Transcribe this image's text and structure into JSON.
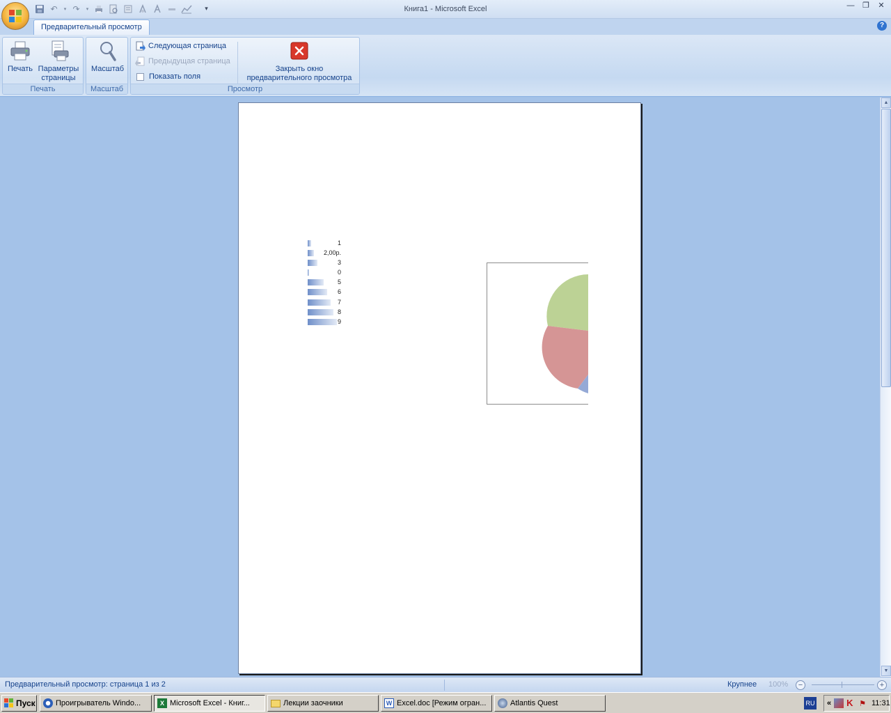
{
  "window": {
    "title": "Книга1  - Microsoft Excel",
    "controls": [
      "minimize-icon",
      "restore-icon",
      "close-icon"
    ]
  },
  "qat": {
    "icons": [
      "save-icon",
      "undo-icon",
      "redo-icon",
      "print-icon",
      "print-preview-icon",
      "spelling-icon",
      "sort-icon",
      "draw-icon",
      "chart-icon",
      "customize-icon"
    ]
  },
  "ribbon": {
    "tab_label": "Предварительный просмотр",
    "groups": {
      "print": {
        "label": "Печать",
        "print_label": "Печать",
        "page_setup_line1": "Параметры",
        "page_setup_line2": "страницы"
      },
      "zoom": {
        "label": "Масштаб",
        "zoom_label": "Масштаб"
      },
      "preview": {
        "label": "Просмотр",
        "next_page": "Следующая страница",
        "prev_page": "Предыдущая страница",
        "show_margins": "Показать поля",
        "close_line1": "Закрыть окно",
        "close_line2": "предварительного просмотра"
      }
    }
  },
  "databars": {
    "labels": [
      "1",
      "2,00р.",
      "3",
      "0",
      "5",
      "6",
      "7",
      "8",
      "9"
    ],
    "values": [
      1,
      2,
      3,
      0,
      5,
      6,
      7,
      8,
      9
    ],
    "max": 9,
    "bar_color": "#6f8fc9"
  },
  "pie": {
    "slice_colors": [
      "#bcd295",
      "#d59595",
      "#95a9d6"
    ]
  },
  "status": {
    "text": "Предварительный просмотр: страница 1 из 2",
    "zoom_label": "Крупнее",
    "zoom_pct": "100%"
  },
  "taskbar": {
    "start": "Пуск",
    "items": [
      "Проигрыватель Windo...",
      "Microsoft Excel - Книг...",
      "Лекции заочники",
      "Excel.doc [Режим огран...",
      "Atlantis Quest"
    ],
    "lang": "RU",
    "tray_arrow": "«",
    "clock": "11:31"
  }
}
